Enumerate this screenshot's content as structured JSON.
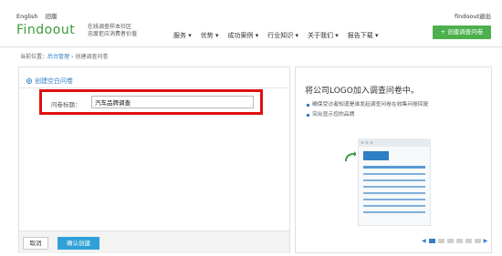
{
  "topbar": {
    "lang_en": "English",
    "lang_cn": "旧版",
    "username": "findoout",
    "logout": "退出"
  },
  "header": {
    "logo": "Findoout",
    "tagline_1": "在线调查样本社区",
    "tagline_2": "忠度拒应消费者价值",
    "nav": [
      {
        "label": "服务 ▾"
      },
      {
        "label": "优势 ▾"
      },
      {
        "label": "成功案例 ▾"
      },
      {
        "label": "行业知识 ▾"
      },
      {
        "label": "关于我们 ▾"
      },
      {
        "label": "报告下载 ▾"
      }
    ],
    "create_button": "+ 创建调查问卷"
  },
  "breadcrumb": {
    "prefix": "当前位置：",
    "link": "后台管理",
    "sep": "›",
    "current": "创建调查问卷"
  },
  "form": {
    "section_title": "创建空白问卷",
    "field_label": "问卷标题：",
    "field_value": "汽车品牌调查",
    "cancel_label": "取消",
    "confirm_label": "确认创建"
  },
  "promo": {
    "title": "将公司LOGO加入调查问卷中。",
    "items": [
      "确保受访者知道是谁发起调查问卷在收集问卷回复",
      "突出显示您的品牌"
    ]
  },
  "colors": {
    "brand_green": "#3a9c3a",
    "create_button": "#4cb04c",
    "link_blue": "#2f7fc6",
    "confirm_blue": "#2fa1d8",
    "highlight_red": "#e01010"
  },
  "pager": {
    "pages": 6,
    "active": 1
  }
}
